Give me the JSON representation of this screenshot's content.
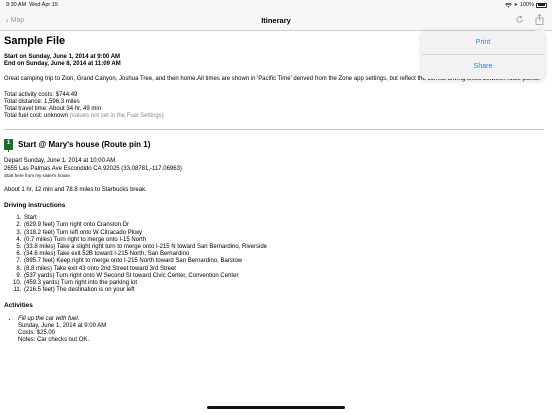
{
  "status_bar": {
    "time": "9:30 AM",
    "date": "Wed Apr 15",
    "battery": "100%"
  },
  "nav": {
    "back_label": "Map",
    "title": "Itinerary"
  },
  "menu": {
    "items": [
      "Print",
      "Share"
    ]
  },
  "doc": {
    "title": "Sample File",
    "start": "Start on Sunday, June 1, 2014 at 9:00 AM",
    "end": "End on Sunday, June 8, 2014 at 11:09 AM",
    "description": "Great camping trip to Zion, Grand Canyon, Joshua Tree, and then home.All times are shown in 'Pacific Time' derived from the Zone app settings, but reflect the correct driving times between route points.",
    "totals": {
      "activity_costs": "Total activity costs: $744.49",
      "distance": "Total distance: 1,596.3 miles",
      "travel_time": "Total travel time: About 34 hr, 49 min",
      "fuel_cost": "Total fuel cost: unknown",
      "fuel_note": "(values not set in the Fuel Settings)"
    }
  },
  "stop": {
    "pin_number": "1",
    "heading": "Start @ Mary's house (Route pin 1)",
    "depart": "Depart Sunday, June 1, 2014 at 10:00 AM",
    "address": "2655 Las Palmas Ave Escondido CA 92025 (33.08781,-117.06963)",
    "note": "Start here from my sister's house.",
    "next_leg": "About 1 hr, 12 min and 78.8 miles to Starbucks break.",
    "driving_title": "Driving instructions",
    "driving": [
      "Start",
      "(629.9 feet) Turn right onto Cranston Dr",
      "(318.2 feet) Turn left onto W Citracado Pkwy",
      "(0.7 miles) Turn right to merge onto I-15 North",
      "(33.8 miles) Take a slight right turn to merge onto I-215 N toward San Bernardino, Riverside",
      "(34.6 miles) Take exit 52B toward I-215 North, San Bernardino",
      "(895.7 feet) Keep right to merge onto I-215 North toward San Bernardino, Barstow",
      "(8.8 miles) Take exit 43 onto 2nd Street toward 3rd Street",
      "(537 yards) Turn right onto W Second St toward Civic Center, Convention Center",
      "(459.3 yards) Turn right into the parking lot",
      "(216.5 feet) The destination is on your left"
    ],
    "activities_title": "Activities",
    "activity": {
      "name": "Fill up the car with fuel.",
      "when": "Sunday, June 1, 2014 at 9:00 AM",
      "cost": "Costs: $25.00",
      "notes": "Notes: Car checks out OK."
    }
  }
}
